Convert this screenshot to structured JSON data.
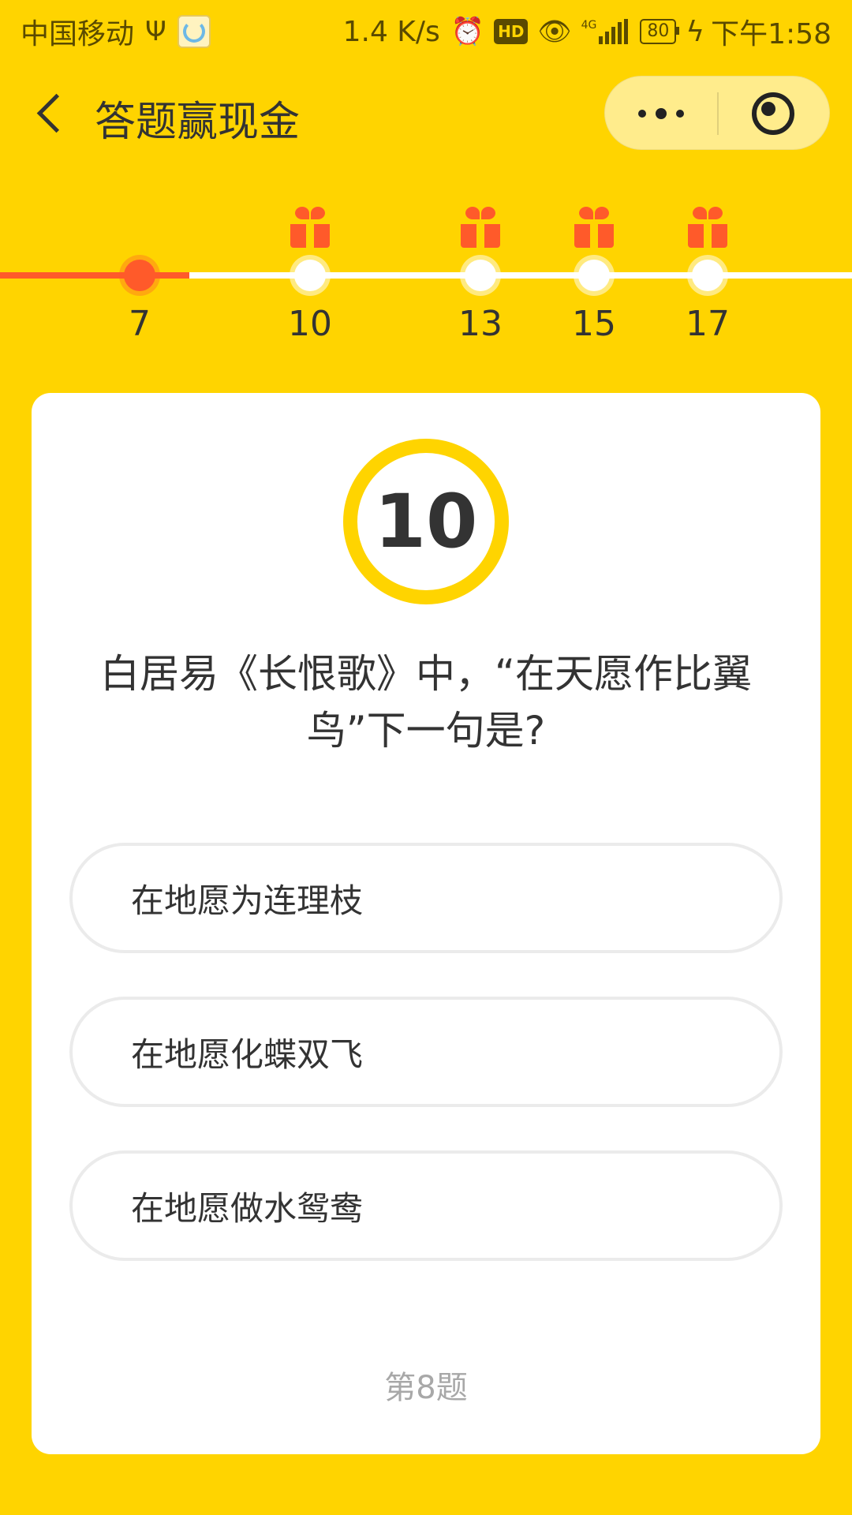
{
  "status_bar": {
    "carrier": "中国移动",
    "speed": "1.4 K/s",
    "network": "4G",
    "battery": "80",
    "time": "下午1:58",
    "icons": [
      "usb-icon",
      "alarm-icon",
      "hd-icon",
      "eye-icon",
      "signal-icon",
      "battery-icon",
      "charging-icon"
    ]
  },
  "header": {
    "title": "答题赢现金",
    "back_icon": "chevron-left-icon",
    "more_icon": "more-dots-icon",
    "close_icon": "target-circle-icon"
  },
  "progress": {
    "current": "7",
    "milestones": [
      {
        "label": "7",
        "gift": false,
        "current": true
      },
      {
        "label": "10",
        "gift": true,
        "current": false
      },
      {
        "label": "13",
        "gift": true,
        "current": false
      },
      {
        "label": "15",
        "gift": true,
        "current": false
      },
      {
        "label": "17",
        "gift": true,
        "current": false
      }
    ]
  },
  "quiz": {
    "timer": "10",
    "question": "白居易《长恨歌》中，“在天愿作比翼鸟”下一句是?",
    "options": [
      {
        "label": "在地愿为连理枝"
      },
      {
        "label": "在地愿化蝶双飞"
      },
      {
        "label": "在地愿做水鸳鸯"
      }
    ],
    "question_number": "第8题"
  },
  "colors": {
    "background": "#FFD400",
    "accent": "#FF5A2A",
    "card": "#FFFFFF",
    "text": "#333333",
    "muted": "#A8A8A8"
  }
}
